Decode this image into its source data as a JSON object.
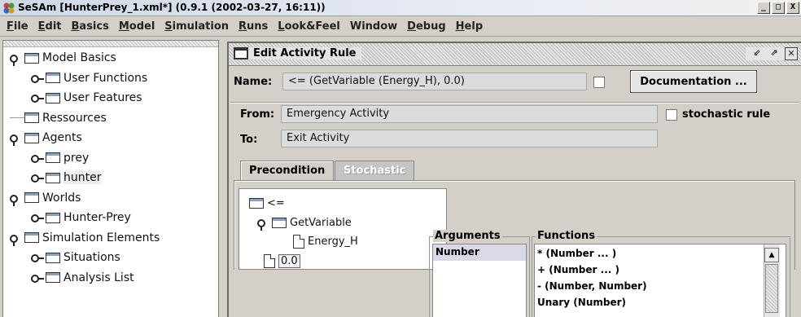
{
  "window": {
    "title": "SeSAm [HunterPrey_1.xml*] (0.9.1 (2002-03-27, 16:11))",
    "buttons": [
      "_",
      "□",
      "X"
    ]
  },
  "menubar": {
    "items": [
      {
        "label": "File",
        "mnemonic": "F",
        "rest": "ile"
      },
      {
        "label": "Edit",
        "mnemonic": "E",
        "rest": "dit"
      },
      {
        "label": "Basics",
        "mnemonic": "B",
        "rest": "asics"
      },
      {
        "label": "Model",
        "mnemonic": "M",
        "rest": "odel"
      },
      {
        "label": "Simulation",
        "mnemonic": "S",
        "rest": "imulation"
      },
      {
        "label": "Runs",
        "mnemonic": "R",
        "rest": "uns"
      },
      {
        "label": "Look&Feel",
        "mnemonic": "L",
        "rest": "ook&Feel"
      },
      {
        "label": "Window",
        "mnemonic": "",
        "rest": "Window"
      },
      {
        "label": "Debug",
        "mnemonic": "D",
        "rest": "ebug"
      },
      {
        "label": "Help",
        "mnemonic": "H",
        "rest": "elp"
      }
    ]
  },
  "tree": {
    "items": [
      {
        "label": "Model Basics",
        "level": 0,
        "expanded": true,
        "handle": true
      },
      {
        "label": "User Functions",
        "level": 1,
        "expanded": false,
        "handle": true
      },
      {
        "label": "User Features",
        "level": 1,
        "expanded": false,
        "handle": true
      },
      {
        "label": "Ressources",
        "level": 0,
        "expanded": false,
        "handle": false
      },
      {
        "label": "Agents",
        "level": 0,
        "expanded": true,
        "handle": true
      },
      {
        "label": "prey",
        "level": 1,
        "expanded": false,
        "handle": true
      },
      {
        "label": "hunter",
        "level": 1,
        "expanded": false,
        "handle": true,
        "selected": true
      },
      {
        "label": "Worlds",
        "level": 0,
        "expanded": true,
        "handle": true
      },
      {
        "label": "Hunter-Prey",
        "level": 1,
        "expanded": false,
        "handle": true
      },
      {
        "label": "Simulation Elements",
        "level": 0,
        "expanded": true,
        "handle": true
      },
      {
        "label": "Situations",
        "level": 1,
        "expanded": false,
        "handle": true
      },
      {
        "label": "Analysis List",
        "level": 1,
        "expanded": false,
        "handle": true
      }
    ]
  },
  "edit_rule": {
    "title": "Edit Activity Rule",
    "name_label": "Name:",
    "name_value": "<= (GetVariable (Energy_H), 0.0)",
    "documentation_label": "Documentation ...",
    "from_label": "From:",
    "from_value": "Emergency Activity",
    "stochastic_label": "stochastic rule",
    "to_label": "To:",
    "to_value": "Exit Activity",
    "tabs": [
      {
        "label": "Precondition",
        "active": true
      },
      {
        "label": "Stochastic",
        "active": false
      }
    ],
    "expr_tree": {
      "root": "<=",
      "child": "GetVariable",
      "grandchild": "Energy_H",
      "leaf": "0.0"
    },
    "arguments": {
      "title": "Arguments",
      "items": [
        "Number"
      ]
    },
    "functions": {
      "title": "Functions",
      "items": [
        "* (Number ... )",
        "+ (Number ... )",
        "- (Number, Number)",
        "Unary (Number)"
      ]
    }
  }
}
